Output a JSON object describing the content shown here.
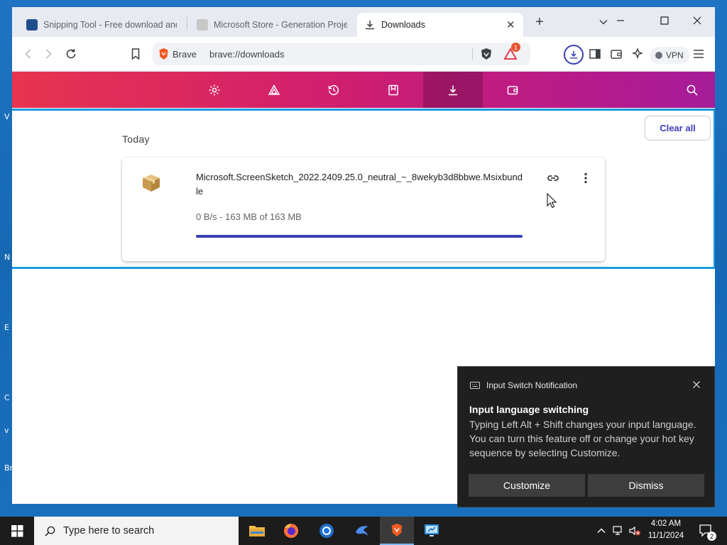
{
  "desktop": {
    "side_labels": [
      "V",
      "N",
      "E",
      "C",
      "v",
      "Br"
    ]
  },
  "browser": {
    "tabs": [
      {
        "label": "Snipping Tool - Free download and",
        "active": false
      },
      {
        "label": "Microsoft Store - Generation Projec",
        "active": false
      },
      {
        "label": "Downloads",
        "active": true
      }
    ],
    "omnibox": {
      "site_label": "Brave",
      "url": "brave://downloads"
    },
    "rewards_badge": "1",
    "vpn_label": "VPN",
    "accent_color": "#3b3fb4"
  },
  "header_nav": [
    {
      "name": "settings-icon",
      "active": false
    },
    {
      "name": "rewards-icon",
      "active": false
    },
    {
      "name": "history-icon",
      "active": false
    },
    {
      "name": "bookmarks-icon",
      "active": false
    },
    {
      "name": "downloads-icon",
      "active": true
    },
    {
      "name": "wallet-icon",
      "active": false
    }
  ],
  "downloads": {
    "clear_all_label": "Clear all",
    "group_label": "Today",
    "items": [
      {
        "file_name": "Microsoft.ScreenSketch_2022.2409.25.0_neutral_~_8wekyb3d8bbwe.Msixbundle",
        "progress_text": "0 B/s - 163 MB of 163 MB",
        "progress_fraction": 1.0
      }
    ]
  },
  "notification": {
    "app_name": "Input Switch Notification",
    "title": "Input language switching",
    "body": "Typing Left Alt + Shift changes your input language. You can turn this feature off or change your hot key sequence by selecting Customize.",
    "customize_label": "Customize",
    "dismiss_label": "Dismiss"
  },
  "taskbar": {
    "search_placeholder": "Type here to search",
    "apps": [
      "file-explorer-icon",
      "firefox-icon",
      "chrome-icon",
      "kali-icon",
      "brave-icon",
      "remote-desktop-icon"
    ],
    "time": "4:02 AM",
    "date": "11/1/2024",
    "notification_count": "2"
  }
}
